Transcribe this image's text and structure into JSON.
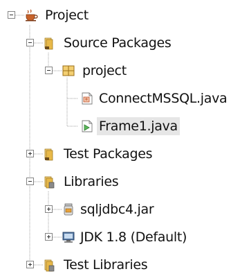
{
  "tree": {
    "project": {
      "label": "Project",
      "icon": "coffee-cup-icon",
      "expanded": true
    },
    "source_packages": {
      "label": "Source Packages",
      "icon": "source-folder-icon",
      "expanded": true
    },
    "package_project": {
      "label": "project",
      "icon": "package-icon",
      "expanded": true
    },
    "file_connect": {
      "label": "ConnectMSSQL.java",
      "icon": "java-class-icon"
    },
    "file_frame": {
      "label": "Frame1.java",
      "icon": "java-form-icon",
      "selected": true
    },
    "test_packages": {
      "label": "Test Packages",
      "icon": "test-folder-icon",
      "expanded": false
    },
    "libraries": {
      "label": "Libraries",
      "icon": "library-folder-icon",
      "expanded": true
    },
    "lib_sqljdbc": {
      "label": "sqljdbc4.jar",
      "icon": "jar-icon",
      "expanded": false
    },
    "lib_jdk": {
      "label": "JDK 1.8 (Default)",
      "icon": "jdk-icon",
      "expanded": false
    },
    "test_libraries": {
      "label": "Test Libraries",
      "icon": "test-library-folder-icon",
      "expanded": false
    }
  },
  "colors": {
    "selection": "#e6e6e6",
    "folder": "#e8b94a",
    "guide_line": "#a0a0a0"
  }
}
